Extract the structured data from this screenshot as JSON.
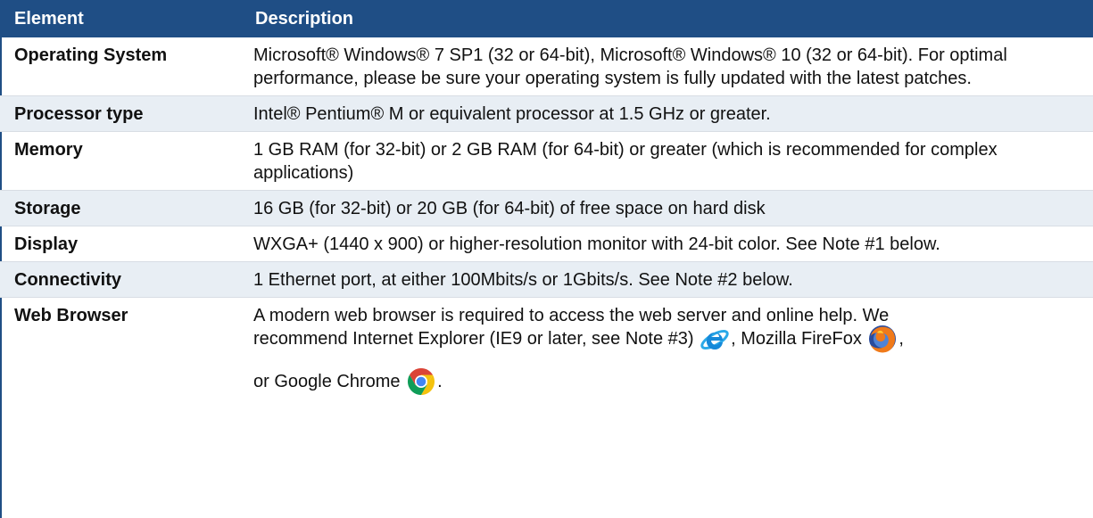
{
  "header": {
    "col_element": "Element",
    "col_description": "Description"
  },
  "rows": [
    {
      "element": "Operating System",
      "description": "Microsoft® Windows® 7 SP1 (32 or 64-bit), Microsoft® Windows® 10 (32 or 64-bit). For optimal performance, please be sure your operating system is fully updated with the latest patches."
    },
    {
      "element": "Processor type",
      "description": "Intel® Pentium® M or equivalent processor at 1.5 GHz or greater."
    },
    {
      "element": "Memory",
      "description": "1 GB RAM (for 32-bit) or 2 GB RAM (for 64-bit) or greater (which is recommended for complex applications)"
    },
    {
      "element": "Storage",
      "description": "16 GB (for 32-bit) or 20 GB (for 64-bit) of free space on hard disk"
    },
    {
      "element": "Display",
      "description": "WXGA+ (1440 x 900) or higher-resolution monitor with 24-bit color. See Note #1 below."
    },
    {
      "element": "Connectivity",
      "description": "1 Ethernet port, at either 100Mbits/s or 1Gbits/s. See Note #2 below."
    }
  ],
  "web_browser": {
    "element": "Web Browser",
    "line1": "A modern web browser is required to access the web server and online help. We",
    "line2_a": "recommend Internet Explorer (IE9 or later, see Note #3)",
    "line2_b": ", Mozilla FireFox",
    "line2_c": ",",
    "line3_a": "or Google Chrome",
    "line3_b": ".",
    "icons": [
      "internet-explorer-icon",
      "firefox-icon",
      "chrome-icon"
    ]
  },
  "colors": {
    "header_bg": "#1f4e85",
    "row_shade": "#e8eef4",
    "header_text": "#ffffff"
  }
}
